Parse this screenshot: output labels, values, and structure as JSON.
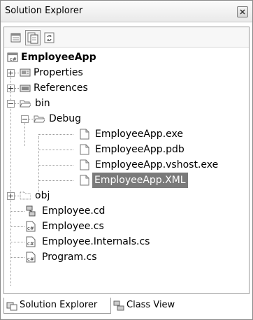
{
  "window": {
    "title": "Solution Explorer",
    "close_icon": "close-icon"
  },
  "toolbar": {
    "buttons": [
      {
        "icon": "properties-icon"
      },
      {
        "icon": "show-all-files-icon",
        "active": true
      },
      {
        "icon": "refresh-icon"
      }
    ]
  },
  "tree": {
    "project": "EmployeeApp",
    "items": {
      "properties": "Properties",
      "references": "References",
      "bin": "bin",
      "debug": "Debug",
      "exe": "EmployeeApp.exe",
      "pdb": "EmployeeApp.pdb",
      "vshost": "EmployeeApp.vshost.exe",
      "xml": "EmployeeApp.XML",
      "obj": "obj",
      "employee_cd": "Employee.cd",
      "employee_cs": "Employee.cs",
      "employee_internals": "Employee.Internals.cs",
      "program": "Program.cs"
    },
    "selected": "EmployeeApp.XML"
  },
  "tabs": [
    {
      "label": "Solution Explorer",
      "active": true
    },
    {
      "label": "Class View",
      "active": false
    }
  ]
}
